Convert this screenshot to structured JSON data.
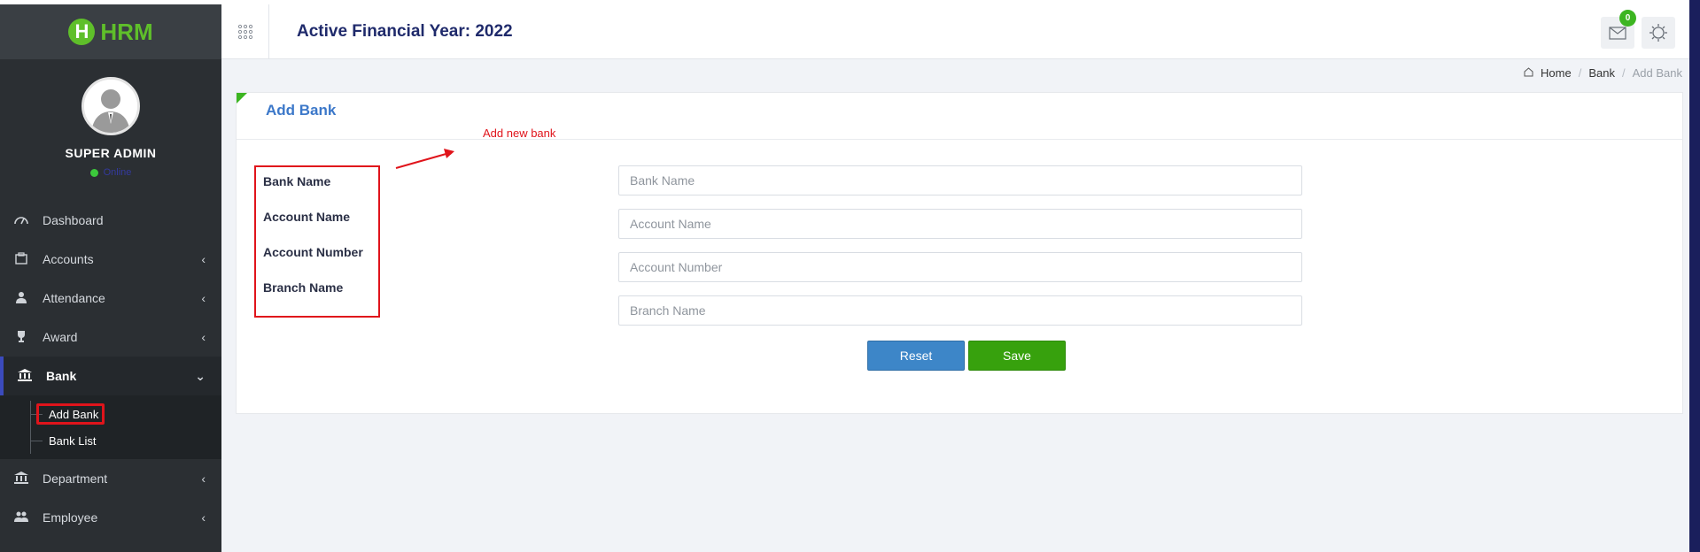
{
  "header": {
    "title": "Active Financial Year: 2022",
    "mail_badge": "0"
  },
  "sidebar": {
    "logo": {
      "letter": "H",
      "text": "HRM"
    },
    "user": {
      "name": "SUPER ADMIN",
      "status": "Online"
    },
    "items": [
      {
        "label": "Dashboard",
        "icon": "dashboard-icon"
      },
      {
        "label": "Accounts",
        "icon": "briefcase-icon"
      },
      {
        "label": "Attendance",
        "icon": "user-icon"
      },
      {
        "label": "Award",
        "icon": "trophy-icon"
      },
      {
        "label": "Bank",
        "icon": "bank-icon"
      },
      {
        "label": "Department",
        "icon": "bank-icon"
      },
      {
        "label": "Employee",
        "icon": "users-icon"
      }
    ],
    "bank_sub": [
      {
        "label": "Add Bank"
      },
      {
        "label": "Bank List"
      }
    ]
  },
  "breadcrumb": {
    "home": "Home",
    "bank": "Bank",
    "current": "Add Bank"
  },
  "card": {
    "title": "Add Bank",
    "annotation": "Add new bank"
  },
  "form": {
    "bank_name": {
      "label": "Bank Name",
      "placeholder": "Bank Name",
      "value": ""
    },
    "account_name": {
      "label": "Account Name",
      "placeholder": "Account Name",
      "value": ""
    },
    "account_number": {
      "label": "Account Number",
      "placeholder": "Account Number",
      "value": ""
    },
    "branch_name": {
      "label": "Branch Name",
      "placeholder": "Branch Name",
      "value": ""
    }
  },
  "buttons": {
    "reset": "Reset",
    "save": "Save"
  },
  "colors": {
    "sidebar_bg": "#2b2f33",
    "accent_green": "#3cb521",
    "accent_blue": "#3d86c8",
    "annotation_red": "#e0141b",
    "title_navy": "#1f2a6b"
  }
}
